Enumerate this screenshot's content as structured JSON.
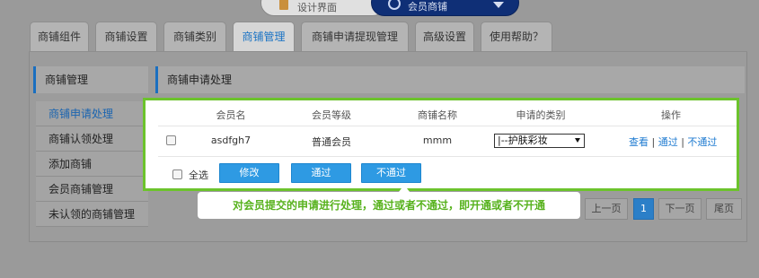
{
  "top_switch": {
    "left_label": "设计界面",
    "right_label": "会员商铺"
  },
  "tabs": [
    "商铺组件",
    "商铺设置",
    "商铺类别",
    "商铺管理",
    "商铺申请提现管理",
    "高级设置",
    "使用帮助？"
  ],
  "active_tab": "商铺管理",
  "sidebar": {
    "title": "商铺管理",
    "items": [
      "商铺申请处理",
      "商铺认领处理",
      "添加商铺",
      "会员商铺管理",
      "未认领的商铺管理"
    ]
  },
  "section_title": "商铺申请处理",
  "table": {
    "headers": [
      "会员名",
      "会员等级",
      "商铺名称",
      "申请的类别",
      "操作"
    ],
    "rows": [
      {
        "member": "asdfgh7",
        "level": "普通会员",
        "shop": "mmm",
        "category": "|--护肤彩妆",
        "ops": [
          "查看",
          "通过",
          "不通过"
        ]
      }
    ]
  },
  "footer": {
    "select_all": "全选",
    "buttons": [
      "修改",
      "通过",
      "不通过"
    ]
  },
  "tooltip": "对会员提交的申请进行处理，通过或者不通过，即开通或者不开通",
  "pagination": {
    "prev": "上一页",
    "current": "1",
    "next": "下一页",
    "last": "尾页"
  },
  "colors": {
    "accent": "#2e9ae3",
    "highlight": "#6cc32c",
    "tooltip_text": "#57b21d"
  }
}
